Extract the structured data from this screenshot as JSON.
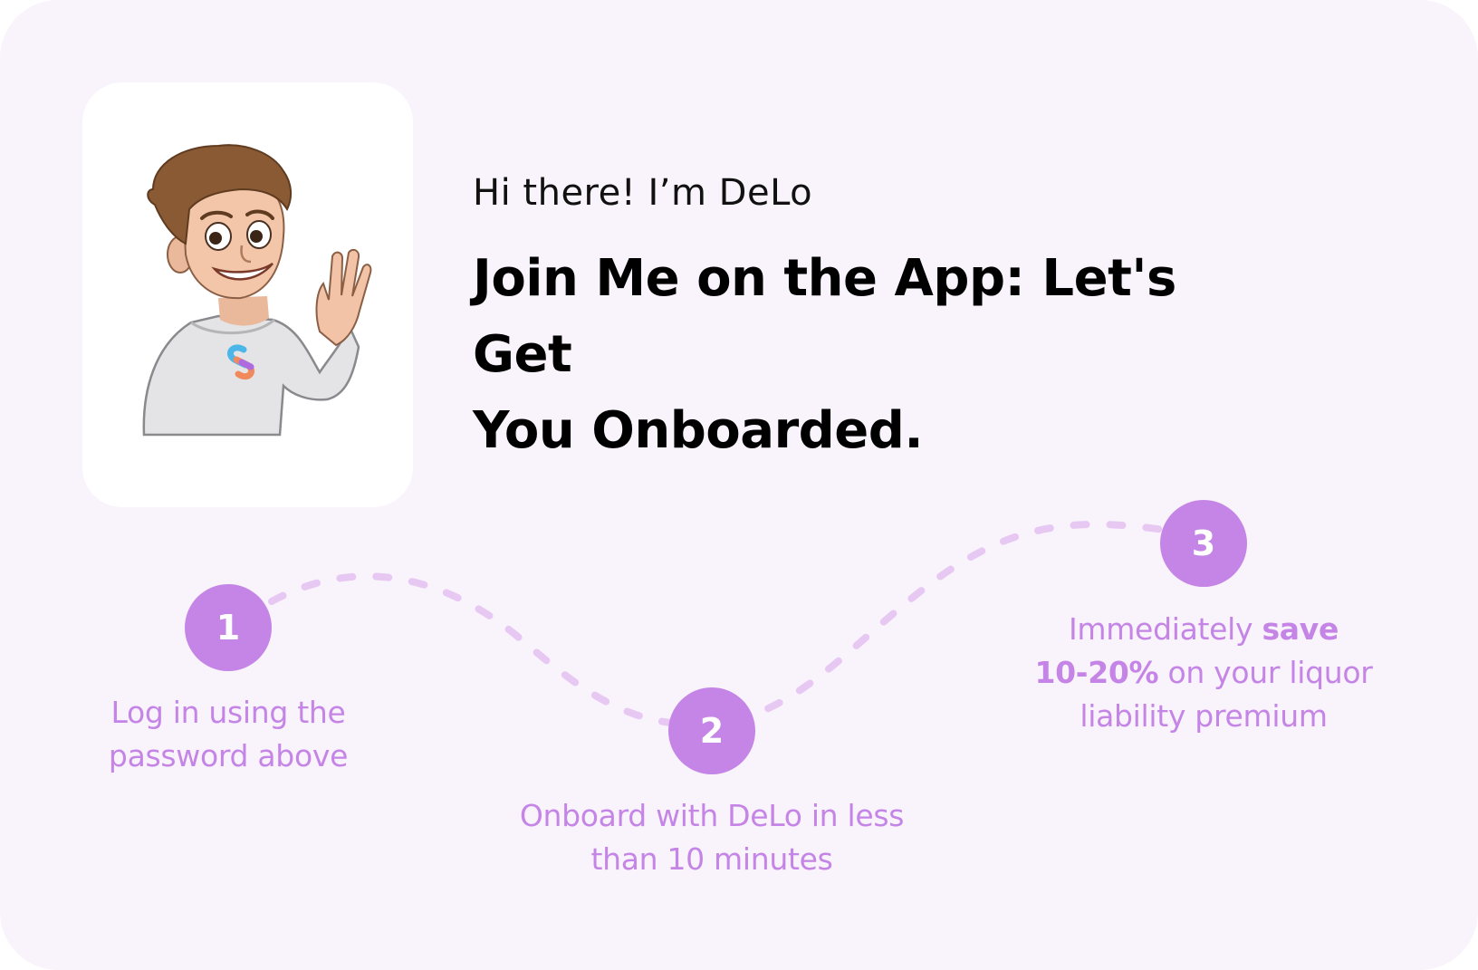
{
  "header": {
    "greeting": "Hi there! I’m DeLo",
    "headline_line1": "Join Me on the App: Let's Get",
    "headline_line2": "You Onboarded."
  },
  "steps": [
    {
      "number": "1",
      "line1": "Log in using the",
      "line2": "password above"
    },
    {
      "number": "2",
      "line1": "Onboard with DeLo in less",
      "line2": "than 10 minutes"
    },
    {
      "number": "3",
      "line1_regular": "Immediately ",
      "line1_bold": "save",
      "line2_bold": "10-20%",
      "line2_regular": " on your liquor",
      "line3": "liability premium"
    }
  ],
  "colors": {
    "accent": "#c585e6",
    "path": "#e7c8f3",
    "background": "#f9f3fb"
  },
  "icons": {
    "mascot": "waving-mascot-illustration",
    "logo": "s-logo-icon"
  }
}
